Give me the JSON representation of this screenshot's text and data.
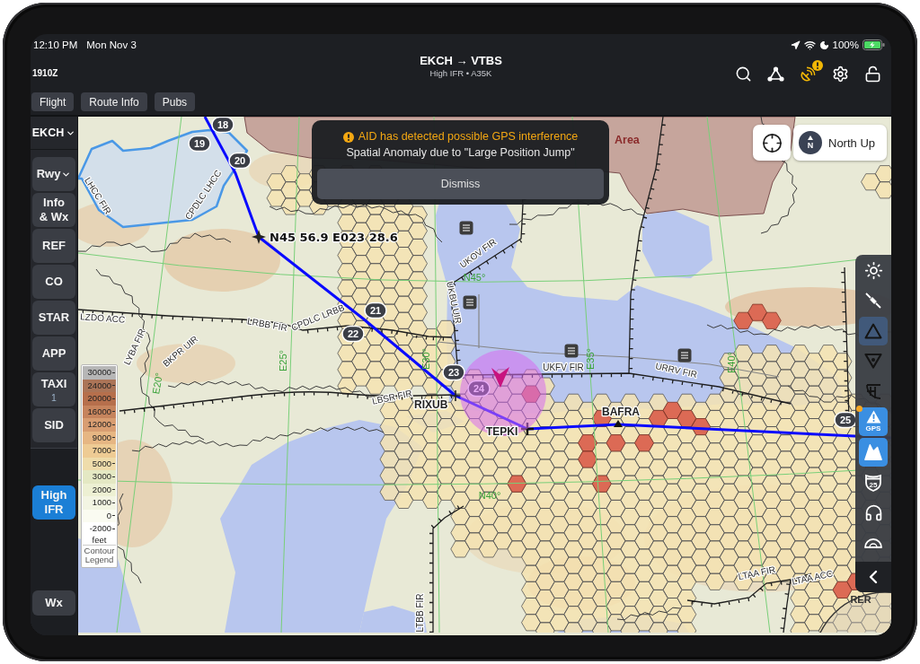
{
  "status_bar": {
    "time": "12:10 PM",
    "date": "Mon Nov 3",
    "battery": "100%"
  },
  "header": {
    "zulu_time": "1910Z",
    "title": "EKCH → VTBS",
    "subtitle": "High IFR • A35K",
    "tools": [
      {
        "alert": false
      },
      {
        "alert": false
      },
      {
        "alert": true
      },
      {
        "alert": false
      },
      {
        "alert": false
      }
    ]
  },
  "tabs": [
    {
      "label": "Flight"
    },
    {
      "label": "Route Info"
    },
    {
      "label": "Pubs"
    }
  ],
  "sidebar": {
    "airport": "EKCH",
    "items": [
      {
        "label": "Rwy",
        "kind": "dropdown"
      },
      {
        "label": "Info\n& Wx",
        "kind": "button"
      },
      {
        "label": "REF",
        "kind": "button"
      },
      {
        "label": "CO",
        "kind": "button"
      },
      {
        "label": "STAR",
        "kind": "button"
      },
      {
        "label": "APP",
        "kind": "button"
      },
      {
        "label": "TAXI",
        "kind": "button",
        "sub": "1"
      },
      {
        "label": "SID",
        "kind": "button"
      }
    ],
    "layers": [
      {
        "label": "High IFR",
        "selected": true
      },
      {
        "label": "Wx",
        "selected": false
      }
    ]
  },
  "alert": {
    "title": "AID has detected possible GPS interference",
    "message": "Spatial Anomaly due to \"Large Position Jump\"",
    "button": "Dismiss"
  },
  "map": {
    "north_up": {
      "label": "North Up",
      "compass": "N"
    },
    "labels": [
      {
        "text": "Area",
        "kind": "area"
      },
      {
        "text": "LHCC FIR",
        "kind": "fir"
      },
      {
        "text": "CPDLC LHCC",
        "kind": "fir"
      },
      {
        "text": "N45 56.9 E023 28.6",
        "kind": "coordinate"
      },
      {
        "text": "UKOV FIR",
        "kind": "fir"
      },
      {
        "text": "N45°",
        "kind": "grid"
      },
      {
        "text": "UKBU UIR",
        "kind": "fir"
      },
      {
        "text": "LRBB FIR",
        "kind": "fir"
      },
      {
        "text": "CPDLC LRBB",
        "kind": "fir"
      },
      {
        "text": "LZDO ACC",
        "kind": "fir"
      },
      {
        "text": "LYBA FIR",
        "kind": "fir"
      },
      {
        "text": "BKPR UIR",
        "kind": "fir"
      },
      {
        "text": "E20°",
        "kind": "grid"
      },
      {
        "text": "E25°",
        "kind": "grid"
      },
      {
        "text": "E30°",
        "kind": "grid"
      },
      {
        "text": "E35°",
        "kind": "grid"
      },
      {
        "text": "E40°",
        "kind": "grid"
      },
      {
        "text": "UKFV FIR",
        "kind": "fir"
      },
      {
        "text": "URRV FIR",
        "kind": "fir"
      },
      {
        "text": "LBSR FIR",
        "kind": "fir"
      },
      {
        "text": "RIXUB",
        "kind": "waypoint"
      },
      {
        "text": "BAFRA",
        "kind": "waypoint"
      },
      {
        "text": "TEPKI",
        "kind": "waypoint"
      },
      {
        "text": "N40°",
        "kind": "grid"
      },
      {
        "text": "LTAA FIR",
        "kind": "fir"
      },
      {
        "text": "LTAA ACC",
        "kind": "fir"
      },
      {
        "text": "RER",
        "kind": "place"
      },
      {
        "text": "LTBB FIR",
        "kind": "fir"
      }
    ],
    "route_markers": [
      "18",
      "19",
      "20",
      "21",
      "22",
      "23",
      "24",
      "25"
    ],
    "tools": [
      {
        "selected": false,
        "highlighted": false,
        "alert": false
      },
      {
        "selected": false,
        "highlighted": false,
        "alert": false
      },
      {
        "selected": false,
        "highlighted": true,
        "alert": false
      },
      {
        "selected": false,
        "highlighted": false,
        "alert": false
      },
      {
        "selected": false,
        "highlighted": false,
        "alert": false
      },
      {
        "selected": true,
        "highlighted": false,
        "alert": true,
        "label": "GPS"
      },
      {
        "selected": true,
        "highlighted": false,
        "alert": false
      },
      {
        "selected": false,
        "highlighted": false,
        "alert": false,
        "label": "25"
      },
      {
        "selected": false,
        "highlighted": false,
        "alert": false
      },
      {
        "selected": false,
        "highlighted": false,
        "alert": false
      }
    ],
    "legend": {
      "bands": [
        {
          "label": "30000",
          "color": "#b6b6b6"
        },
        {
          "label": "24000",
          "color": "#ab7457"
        },
        {
          "label": "20000",
          "color": "#b66f4c"
        },
        {
          "label": "16000",
          "color": "#c6845d"
        },
        {
          "label": "12000",
          "color": "#d89d71"
        },
        {
          "label": "9000",
          "color": "#e6b683"
        },
        {
          "label": "7000",
          "color": "#eecb94"
        },
        {
          "label": "5000",
          "color": "#efdcab"
        },
        {
          "label": "3000",
          "color": "#e4e8c3"
        },
        {
          "label": "2000",
          "color": "#edf0d3"
        },
        {
          "label": "1000",
          "color": "#f3f5e3"
        },
        {
          "label": "0",
          "color": "#fafbf1"
        },
        {
          "label": "-2000",
          "color": "#ffffff"
        }
      ],
      "unit": "feet",
      "title": "Contour Legend"
    }
  }
}
